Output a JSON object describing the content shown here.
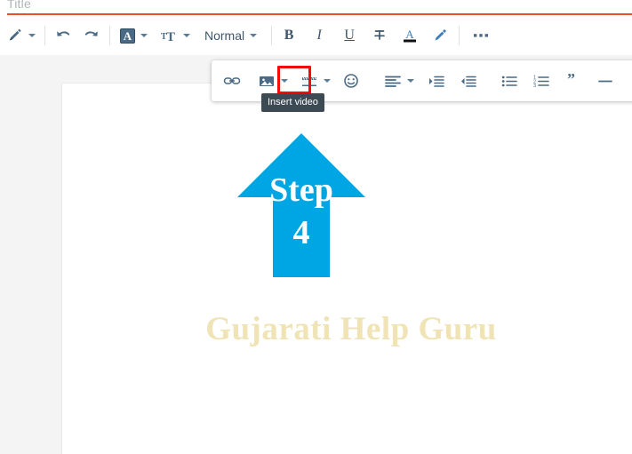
{
  "title_bar": {
    "placeholder": "Title",
    "underline_color": "#e8502a"
  },
  "main_toolbar": {
    "items": [
      {
        "name": "pen-tool",
        "label": "",
        "icon": "pen-icon",
        "has_caret": true
      },
      {
        "name": "undo",
        "label": "",
        "icon": "undo-icon",
        "has_caret": false
      },
      {
        "name": "redo",
        "label": "",
        "icon": "redo-icon",
        "has_caret": false
      },
      {
        "name": "font-family",
        "label": "",
        "icon": "font-a-icon",
        "has_caret": true
      },
      {
        "name": "font-size",
        "label": "",
        "icon": "font-size-icon",
        "has_caret": true
      },
      {
        "name": "paragraph-style",
        "label": "Normal",
        "icon": "",
        "has_caret": true
      },
      {
        "name": "bold",
        "label": "B",
        "icon": "bold-icon",
        "has_caret": false
      },
      {
        "name": "italic",
        "label": "I",
        "icon": "italic-icon",
        "has_caret": false
      },
      {
        "name": "underline",
        "label": "U",
        "icon": "underline-icon",
        "has_caret": false
      },
      {
        "name": "strikethrough",
        "label": "",
        "icon": "strikethrough-icon",
        "has_caret": false
      },
      {
        "name": "text-color",
        "label": "A",
        "icon": "text-color-icon",
        "has_caret": false
      },
      {
        "name": "highlight",
        "label": "",
        "icon": "highlight-pen-icon",
        "has_caret": false
      },
      {
        "name": "more-options",
        "label": "",
        "icon": "more-horizontal-icon",
        "has_caret": false
      }
    ],
    "paragraph_style_value": "Normal",
    "bold_label": "B",
    "italic_label": "I",
    "underline_label": "U",
    "text_color_label": "A"
  },
  "popup_toolbar": {
    "items": [
      {
        "name": "insert-link",
        "icon": "link-icon",
        "has_caret": false,
        "active": false
      },
      {
        "name": "insert-image",
        "icon": "image-icon",
        "has_caret": true,
        "active": false
      },
      {
        "name": "insert-video",
        "icon": "video-clapper-icon",
        "has_caret": true,
        "active": true
      },
      {
        "name": "insert-emoji",
        "icon": "emoji-smiley-icon",
        "has_caret": false,
        "active": false
      },
      {
        "name": "text-align",
        "icon": "align-left-icon",
        "has_caret": true,
        "active": false
      },
      {
        "name": "indent-increase",
        "icon": "indent-increase-icon",
        "has_caret": false,
        "active": false
      },
      {
        "name": "indent-decrease",
        "icon": "indent-decrease-icon",
        "has_caret": false,
        "active": false
      },
      {
        "name": "bulleted-list",
        "icon": "bulleted-list-icon",
        "has_caret": false,
        "active": false
      },
      {
        "name": "numbered-list",
        "icon": "numbered-list-icon",
        "has_caret": false,
        "active": false
      },
      {
        "name": "block-quote",
        "icon": "quote-icon",
        "has_caret": false,
        "active": false
      },
      {
        "name": "horizontal-rule",
        "icon": "horizontal-rule-icon",
        "has_caret": false,
        "active": false
      },
      {
        "name": "direction-ltr",
        "icon": "paragraph-ltr-icon",
        "has_caret": false,
        "active": false
      },
      {
        "name": "direction-rtl",
        "icon": "paragraph-rtl-icon",
        "has_caret": false,
        "active": false
      },
      {
        "name": "language",
        "icon": "globe-icon",
        "has_caret": false,
        "active": false
      }
    ],
    "highlight_color": "#f30c0c"
  },
  "tooltip": {
    "text": "Insert video",
    "background": "#3c4a54"
  },
  "document": {
    "arrow": {
      "step_label": "Step",
      "step_number": "4",
      "color": "#00a5e3"
    },
    "watermark": {
      "text": "Gujarati Help Guru",
      "color": "#f0e3b5"
    },
    "page_background": "#ffffff",
    "canvas_background": "#f4f4f4"
  }
}
